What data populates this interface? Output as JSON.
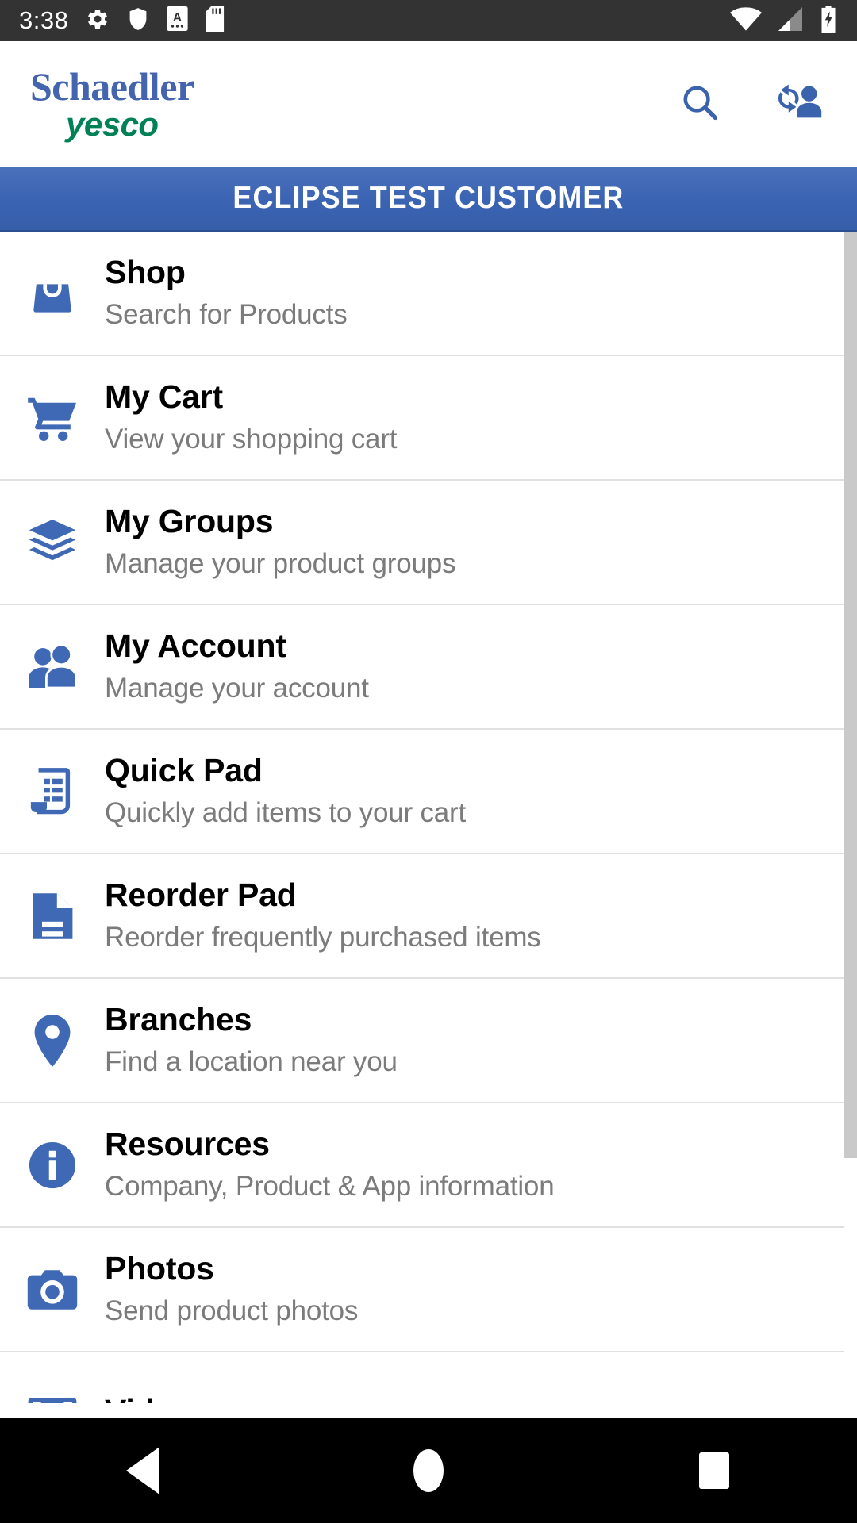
{
  "status_bar": {
    "time": "3:38",
    "left_icons": [
      "gear-icon",
      "shield-icon",
      "app-notification-icon",
      "sd-card-icon"
    ],
    "right_icons": [
      "wifi-icon",
      "cell-signal-icon",
      "battery-charging-icon"
    ],
    "background_color": "#333333"
  },
  "header": {
    "logo_top": "Schaedler",
    "logo_bottom": "yesco",
    "logo_top_color": "#4464b0",
    "logo_bottom_color": "#008055",
    "actions": [
      {
        "name": "search-icon",
        "label": "Search"
      },
      {
        "name": "switch-user-icon",
        "label": "Switch User"
      }
    ]
  },
  "customer_banner": {
    "label": "ECLIPSE TEST CUSTOMER",
    "background_color": "#3f68b5",
    "text_color": "#ffffff"
  },
  "menu": {
    "accent_color": "#3f68b5",
    "items": [
      {
        "icon": "shopping-bag-icon",
        "title": "Shop",
        "subtitle": "Search for Products"
      },
      {
        "icon": "shopping-cart-icon",
        "title": "My Cart",
        "subtitle": "View your shopping cart"
      },
      {
        "icon": "layers-icon",
        "title": "My Groups",
        "subtitle": "Manage your product groups"
      },
      {
        "icon": "people-icon",
        "title": "My Account",
        "subtitle": "Manage your account"
      },
      {
        "icon": "list-document-icon",
        "title": "Quick Pad",
        "subtitle": "Quickly add items to your cart"
      },
      {
        "icon": "document-icon",
        "title": "Reorder Pad",
        "subtitle": "Reorder frequently purchased items"
      },
      {
        "icon": "map-pin-icon",
        "title": "Branches",
        "subtitle": "Find a location near you"
      },
      {
        "icon": "info-circle-icon",
        "title": "Resources",
        "subtitle": "Company, Product & App information"
      },
      {
        "icon": "camera-icon",
        "title": "Photos",
        "subtitle": "Send product photos"
      },
      {
        "icon": "film-icon",
        "title": "Videos",
        "subtitle": ""
      }
    ]
  },
  "nav_bar": {
    "buttons": [
      {
        "name": "back-button",
        "label": "Back"
      },
      {
        "name": "home-button",
        "label": "Home"
      },
      {
        "name": "recents-button",
        "label": "Recents"
      }
    ]
  }
}
